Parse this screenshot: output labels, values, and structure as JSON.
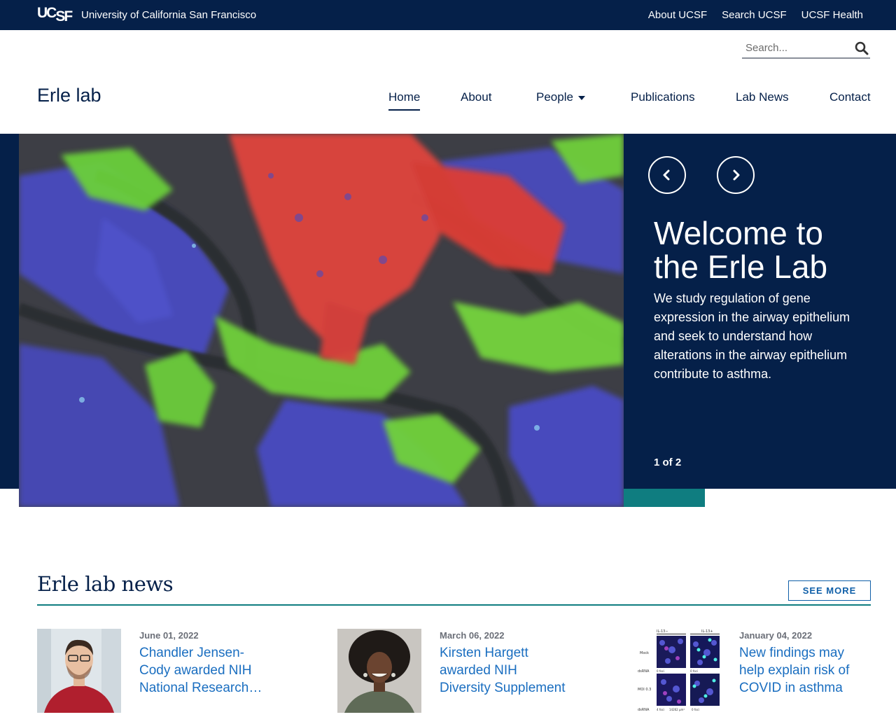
{
  "topbar": {
    "logo_text": "UCSF",
    "university": "University of California San Francisco",
    "links": [
      "About UCSF",
      "Search UCSF",
      "UCSF Health"
    ],
    "background": "#052049"
  },
  "search": {
    "placeholder": "Search..."
  },
  "header": {
    "site_name": "Erle lab"
  },
  "nav": {
    "home": "Home",
    "about": "About",
    "people": "People",
    "publications": "Publications",
    "lab_news": "Lab News",
    "contact": "Contact",
    "active": "Home"
  },
  "hero": {
    "title": "Welcome to the Erle Lab",
    "text": "We study regulation of gene expression in the airway epithelium and seek to understand how alterations in the airway epithelium contribute to asthma.",
    "counter": "1 of 2",
    "colors": {
      "panel": "#052049",
      "accent": "#0f7d80"
    }
  },
  "news": {
    "title": "Erle lab news",
    "see_more": "SEE MORE",
    "items": [
      {
        "date": "June 01, 2022",
        "headline": "Chandler Jensen-Cody awarded NIH National Research Service Award"
      },
      {
        "date": "March 06, 2022",
        "headline": "Kirsten Hargett awarded NIH Diversity Supplement"
      },
      {
        "date": "January 04, 2022",
        "headline": "New findings may help explain risk of COVID in asthma"
      }
    ],
    "figure_labels": {
      "columns": [
        "IL-13−",
        "IL-13+"
      ],
      "rows": [
        "Mock",
        "dsRNA",
        "MOI 0.3",
        "dsRNA"
      ],
      "foci": [
        "0 foci",
        "0 foci",
        "4 foci",
        "14262 μm²",
        "0 foci"
      ]
    },
    "link_color": "#1a6ec0"
  }
}
